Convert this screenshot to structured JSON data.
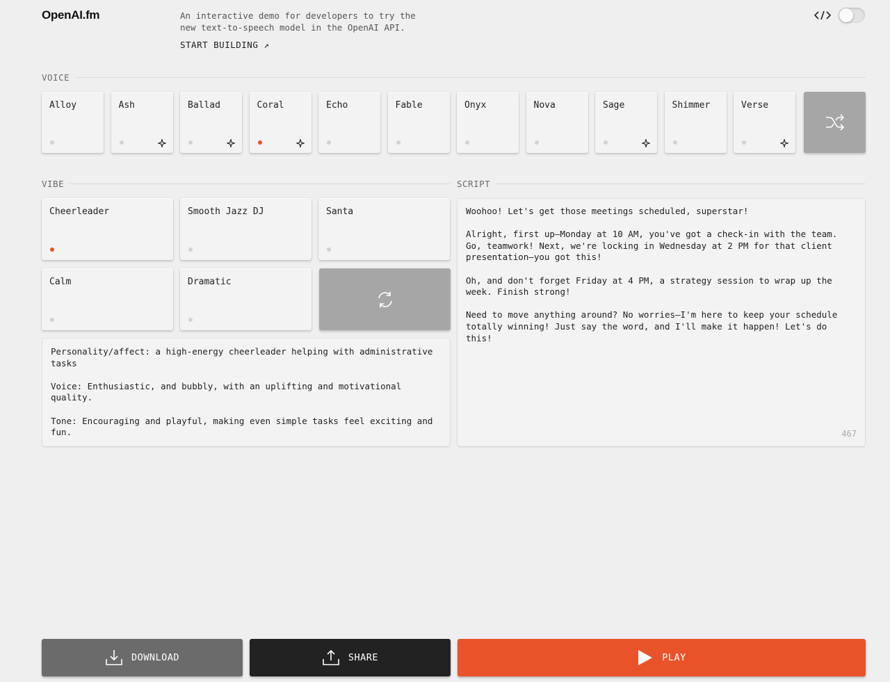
{
  "header": {
    "logo": "OpenAI.fm",
    "intro": "An interactive demo for developers to try the new text-to-speech model in the OpenAI API.",
    "start_building": "START BUILDING ↗",
    "toggle_state": "off"
  },
  "voice": {
    "label": "VOICE",
    "items": [
      {
        "label": "Alloy",
        "active": false,
        "sparkle": false
      },
      {
        "label": "Ash",
        "active": false,
        "sparkle": true
      },
      {
        "label": "Ballad",
        "active": false,
        "sparkle": true
      },
      {
        "label": "Coral",
        "active": true,
        "sparkle": true
      },
      {
        "label": "Echo",
        "active": false,
        "sparkle": false
      },
      {
        "label": "Fable",
        "active": false,
        "sparkle": false
      },
      {
        "label": "Onyx",
        "active": false,
        "sparkle": false
      },
      {
        "label": "Nova",
        "active": false,
        "sparkle": false
      },
      {
        "label": "Sage",
        "active": false,
        "sparkle": true
      },
      {
        "label": "Shimmer",
        "active": false,
        "sparkle": false
      },
      {
        "label": "Verse",
        "active": false,
        "sparkle": true
      }
    ]
  },
  "vibe": {
    "label": "VIBE",
    "items": [
      {
        "label": "Cheerleader",
        "active": true
      },
      {
        "label": "Smooth Jazz DJ",
        "active": false
      },
      {
        "label": "Santa",
        "active": false
      },
      {
        "label": "Calm",
        "active": false
      },
      {
        "label": "Dramatic",
        "active": false
      }
    ],
    "description": [
      "Personality/affect: a high-energy cheerleader helping with administrative tasks",
      "Voice: Enthusiastic, and bubbly, with an uplifting and motivational quality.",
      "Tone: Encouraging and playful, making even simple tasks feel exciting and fun."
    ]
  },
  "script": {
    "label": "SCRIPT",
    "paragraphs": [
      "Woohoo! Let's get those meetings scheduled, superstar!",
      "Alright, first up—Monday at 10 AM, you've got a check-in with the team. Go, teamwork! Next, we're locking in Wednesday at 2 PM for that client presentation—you got this!",
      "Oh, and don't forget Friday at 4 PM, a strategy session to wrap up the week. Finish strong!",
      "Need to move anything around? No worries—I'm here to keep your schedule totally winning! Just say the word, and I'll make it happen! Let's do this!"
    ],
    "char_count": "467"
  },
  "actions": {
    "download": "DOWNLOAD",
    "share": "SHARE",
    "play": "PLAY"
  },
  "colors": {
    "accent": "#e8532a",
    "download_bg": "#6b6b6b",
    "share_bg": "#222222",
    "play_bg": "#e8532a"
  }
}
